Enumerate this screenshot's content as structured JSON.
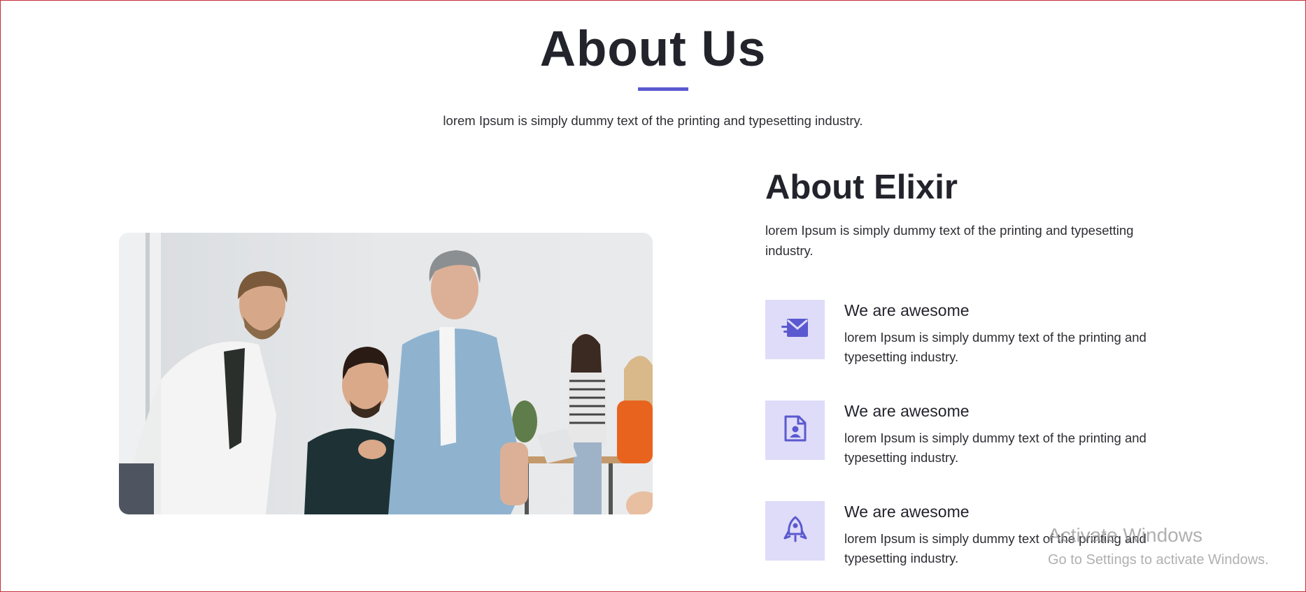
{
  "section": {
    "title": "About Us",
    "subtitle": "lorem Ipsum is simply dummy text of the printing and typesetting industry.",
    "accent_color": "#5b59cf"
  },
  "about": {
    "heading": "About Elixir",
    "text": "lorem Ipsum is simply dummy text of the printing and typesetting industry."
  },
  "features": [
    {
      "icon": "envelope-icon",
      "title": "We are awesome",
      "text": "lorem Ipsum is simply dummy text of the printing and typesetting industry."
    },
    {
      "icon": "contact-file-icon",
      "title": "We are awesome",
      "text": "lorem Ipsum is simply dummy text of the printing and typesetting industry."
    },
    {
      "icon": "rocket-icon",
      "title": "We are awesome",
      "text": "lorem Ipsum is simply dummy text of the printing and typesetting industry."
    }
  ],
  "watermark": {
    "title": "Activate Windows",
    "subtitle": "Go to Settings to activate Windows."
  }
}
